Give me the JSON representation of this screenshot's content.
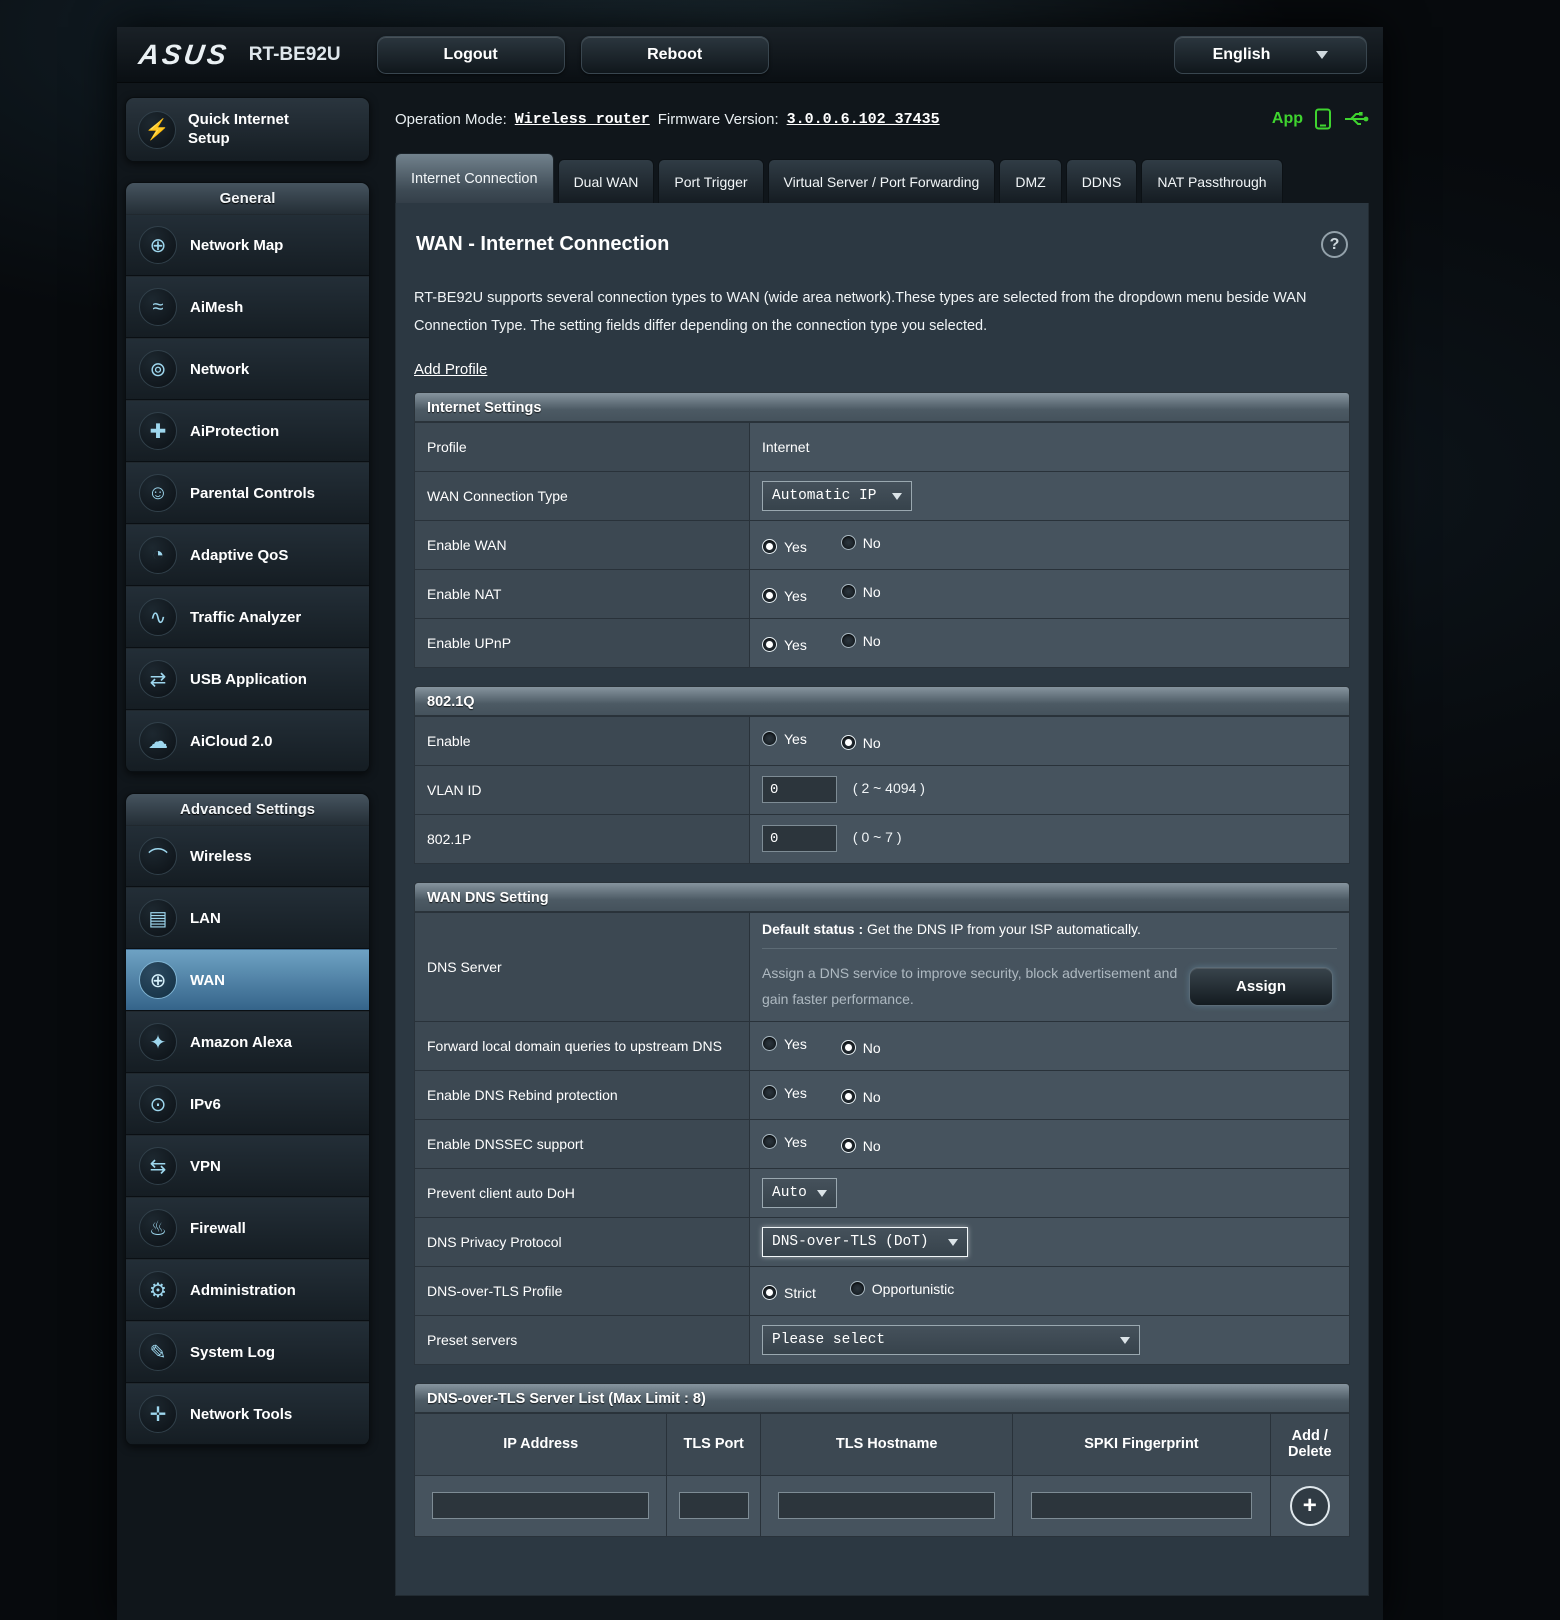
{
  "header": {
    "brand": "ASUS",
    "model": "RT-BE92U",
    "logout_label": "Logout",
    "reboot_label": "Reboot",
    "language_label": "English"
  },
  "statusbar": {
    "operation_mode_label": "Operation Mode:",
    "operation_mode_value": "Wireless router",
    "firmware_label": "Firmware Version:",
    "firmware_value": "3.0.0.6.102_37435",
    "app_label": "App"
  },
  "sidebar": {
    "qis_label": "Quick Internet Setup",
    "qis_glyph": "⚡",
    "general_header": "General",
    "general_items": [
      {
        "label": "Network Map",
        "glyph": "⊕"
      },
      {
        "label": "AiMesh",
        "glyph": "≈"
      },
      {
        "label": "Network",
        "glyph": "⊚"
      },
      {
        "label": "AiProtection",
        "glyph": "✚"
      },
      {
        "label": "Parental Controls",
        "glyph": "☺"
      },
      {
        "label": "Adaptive QoS",
        "glyph": "◔"
      },
      {
        "label": "Traffic Analyzer",
        "glyph": "∿"
      },
      {
        "label": "USB Application",
        "glyph": "⇄"
      },
      {
        "label": "AiCloud 2.0",
        "glyph": "☁"
      }
    ],
    "advanced_header": "Advanced Settings",
    "advanced_items": [
      {
        "label": "Wireless",
        "glyph": "⌒"
      },
      {
        "label": "LAN",
        "glyph": "▤"
      },
      {
        "label": "WAN",
        "glyph": "⊕",
        "active": true
      },
      {
        "label": "Amazon Alexa",
        "glyph": "✦"
      },
      {
        "label": "IPv6",
        "glyph": "⊙"
      },
      {
        "label": "VPN",
        "glyph": "⇆"
      },
      {
        "label": "Firewall",
        "glyph": "♨"
      },
      {
        "label": "Administration",
        "glyph": "⚙"
      },
      {
        "label": "System Log",
        "glyph": "✎"
      },
      {
        "label": "Network Tools",
        "glyph": "✛"
      }
    ]
  },
  "tabs": {
    "items": [
      "Internet Connection",
      "Dual WAN",
      "Port Trigger",
      "Virtual Server / Port Forwarding",
      "DMZ",
      "DDNS",
      "NAT Passthrough"
    ],
    "active": "Internet Connection"
  },
  "page": {
    "title": "WAN - Internet Connection",
    "help_glyph": "?",
    "description": "RT-BE92U supports several connection types to WAN (wide area network).These types are selected from the dropdown menu beside WAN Connection Type. The setting fields differ depending on the connection type you selected.",
    "add_profile_label": "Add Profile"
  },
  "internet_settings": {
    "title": "Internet Settings",
    "profile_label": "Profile",
    "profile_value": "Internet",
    "wan_type_label": "WAN Connection Type",
    "wan_type_value": "Automatic IP",
    "enable_wan_label": "Enable WAN",
    "enable_wan_selected": "Yes",
    "enable_nat_label": "Enable NAT",
    "enable_nat_selected": "Yes",
    "enable_upnp_label": "Enable UPnP",
    "enable_upnp_selected": "Yes",
    "yes_label": "Yes",
    "no_label": "No"
  },
  "dot1q": {
    "title": "802.1Q",
    "enable_label": "Enable",
    "enable_selected": "No",
    "vlan_label": "VLAN ID",
    "vlan_value": "0",
    "vlan_hint": "( 2 ~ 4094 )",
    "p8021_label": "802.1P",
    "p8021_value": "0",
    "p8021_hint": "( 0 ~ 7 )"
  },
  "wan_dns": {
    "title": "WAN DNS Setting",
    "dns_server_label": "DNS Server",
    "default_status_label": "Default status :",
    "default_status_text": " Get the DNS IP from your ISP automatically.",
    "assign_text": "Assign a DNS service to improve security, block advertisement and gain faster performance.",
    "assign_button": "Assign",
    "forward_label": "Forward local domain queries to upstream DNS",
    "forward_selected": "No",
    "rebind_label": "Enable DNS Rebind protection",
    "rebind_selected": "No",
    "dnssec_label": "Enable DNSSEC support",
    "dnssec_selected": "No",
    "doh_label": "Prevent client auto DoH",
    "doh_value": "Auto",
    "privacy_label": "DNS Privacy Protocol",
    "privacy_value": "DNS-over-TLS (DoT)",
    "dot_profile_label": "DNS-over-TLS Profile",
    "strict_label": "Strict",
    "opportunistic_label": "Opportunistic",
    "dot_profile_selected": "Strict",
    "preset_label": "Preset servers",
    "preset_value": "Please select",
    "yes_label": "Yes",
    "no_label": "No"
  },
  "dot_server_list": {
    "title": "DNS-over-TLS Server List (Max Limit : 8)",
    "headers": [
      "IP Address",
      "TLS Port",
      "TLS Hostname",
      "SPKI Fingerprint",
      "Add / Delete"
    ],
    "add_button_glyph": "+"
  }
}
